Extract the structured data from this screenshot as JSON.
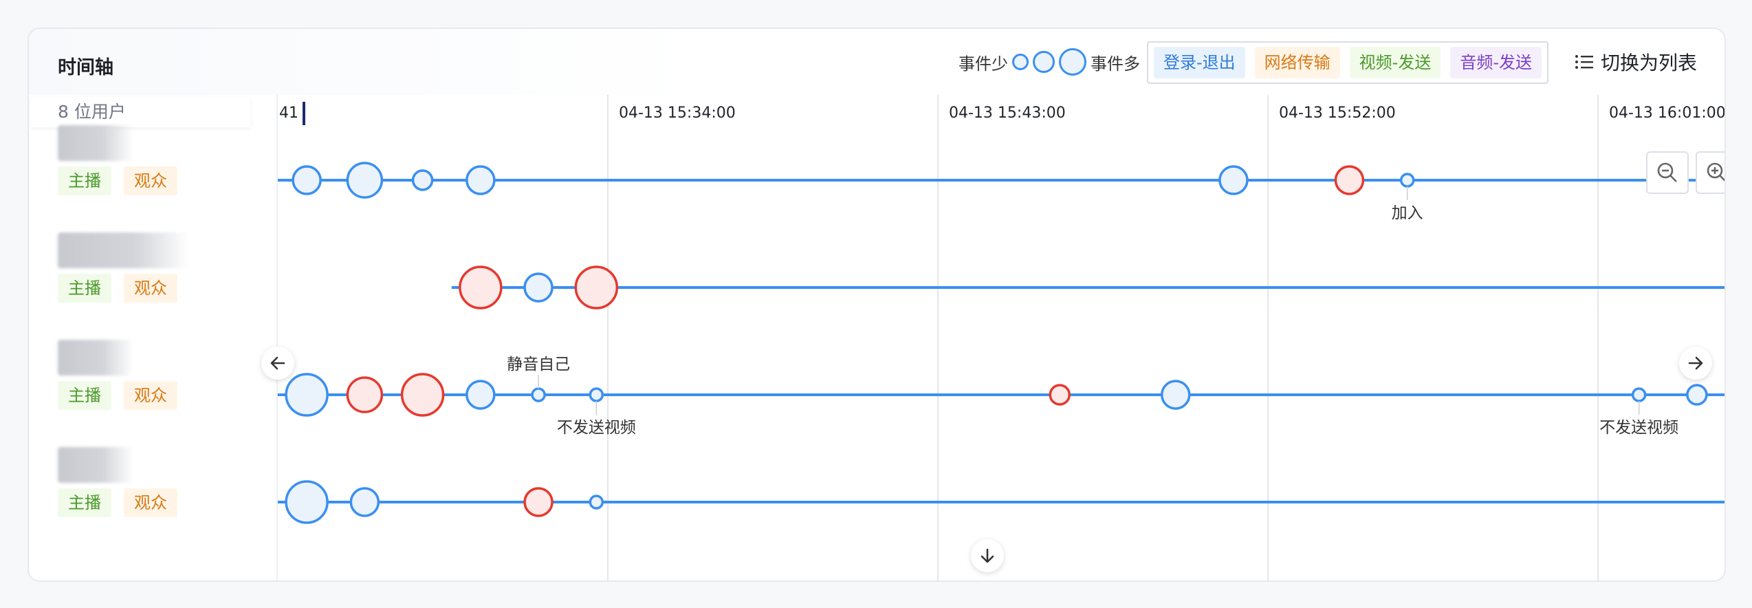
{
  "header": {
    "title": "时间轴",
    "size_legend": {
      "less": "事件少",
      "more": "事件多"
    },
    "categories": [
      {
        "label": "登录-退出",
        "bg": "#e8f2fd",
        "color": "#2f7bd9"
      },
      {
        "label": "网络传输",
        "bg": "#fff4e6",
        "color": "#d87a14"
      },
      {
        "label": "视频-发送",
        "bg": "#f2fbea",
        "color": "#4a9a2b"
      },
      {
        "label": "音频-发送",
        "bg": "#f5effc",
        "color": "#7b3fc8"
      }
    ],
    "switch_label": "切换为列表"
  },
  "user_count": "8 位用户",
  "users": [
    {
      "roles": [
        "主播",
        "观众"
      ]
    },
    {
      "roles": [
        "主播",
        "观众"
      ]
    },
    {
      "roles": [
        "主播",
        "观众"
      ]
    },
    {
      "roles": [
        "主播",
        "观众"
      ]
    }
  ],
  "axis": {
    "partial_label": "41",
    "ticks": [
      "04-13 15:34:00",
      "04-13 15:43:00",
      "04-13 15:52:00",
      "04-13 16:01:00"
    ]
  },
  "colors": {
    "line": "#3b8ff0",
    "normal_fill": "#eaf3fb",
    "normal_stroke": "#3b8ff0",
    "error_fill": "#fde9e8",
    "error_stroke": "#e5392f",
    "grid": "#e4e6ea"
  },
  "timeline": [
    {
      "start": 0.0,
      "events": [
        {
          "pos": 0.02,
          "size": "m",
          "status": "normal"
        },
        {
          "pos": 0.06,
          "size": "l",
          "status": "normal"
        },
        {
          "pos": 0.1,
          "size": "s",
          "status": "normal"
        },
        {
          "pos": 0.14,
          "size": "m",
          "status": "normal"
        },
        {
          "pos": 0.66,
          "size": "m",
          "status": "normal"
        },
        {
          "pos": 0.74,
          "size": "m",
          "status": "error"
        },
        {
          "pos": 0.78,
          "size": "xs",
          "status": "normal",
          "label": "加入",
          "label_pos": "below"
        }
      ]
    },
    {
      "start": 0.12,
      "events": [
        {
          "pos": 0.14,
          "size": "xl",
          "status": "error"
        },
        {
          "pos": 0.18,
          "size": "m",
          "status": "normal"
        },
        {
          "pos": 0.22,
          "size": "xl",
          "status": "error"
        }
      ]
    },
    {
      "start": 0.0,
      "events": [
        {
          "pos": 0.02,
          "size": "xl",
          "status": "normal"
        },
        {
          "pos": 0.06,
          "size": "l",
          "status": "error"
        },
        {
          "pos": 0.1,
          "size": "xl",
          "status": "error"
        },
        {
          "pos": 0.14,
          "size": "m",
          "status": "normal"
        },
        {
          "pos": 0.18,
          "size": "xs",
          "status": "normal",
          "label": "静音自己",
          "label_pos": "above"
        },
        {
          "pos": 0.22,
          "size": "xs",
          "status": "normal",
          "label": "不发送视频",
          "label_pos": "below"
        },
        {
          "pos": 0.54,
          "size": "s",
          "status": "error"
        },
        {
          "pos": 0.62,
          "size": "m",
          "status": "normal"
        },
        {
          "pos": 0.94,
          "size": "xs",
          "status": "normal",
          "label": "不发送视频",
          "label_pos": "below"
        },
        {
          "pos": 0.98,
          "size": "s",
          "status": "normal"
        }
      ]
    },
    {
      "start": 0.0,
      "events": [
        {
          "pos": 0.02,
          "size": "xl",
          "status": "normal"
        },
        {
          "pos": 0.06,
          "size": "m",
          "status": "normal"
        },
        {
          "pos": 0.18,
          "size": "m",
          "status": "error"
        },
        {
          "pos": 0.22,
          "size": "xs",
          "status": "normal"
        }
      ]
    }
  ],
  "icons": {
    "list": "list-icon",
    "left": "arrow-left-icon",
    "right": "arrow-right-icon",
    "down": "arrow-down-icon",
    "zoom_out": "zoom-out-icon",
    "zoom_in": "zoom-in-icon"
  }
}
